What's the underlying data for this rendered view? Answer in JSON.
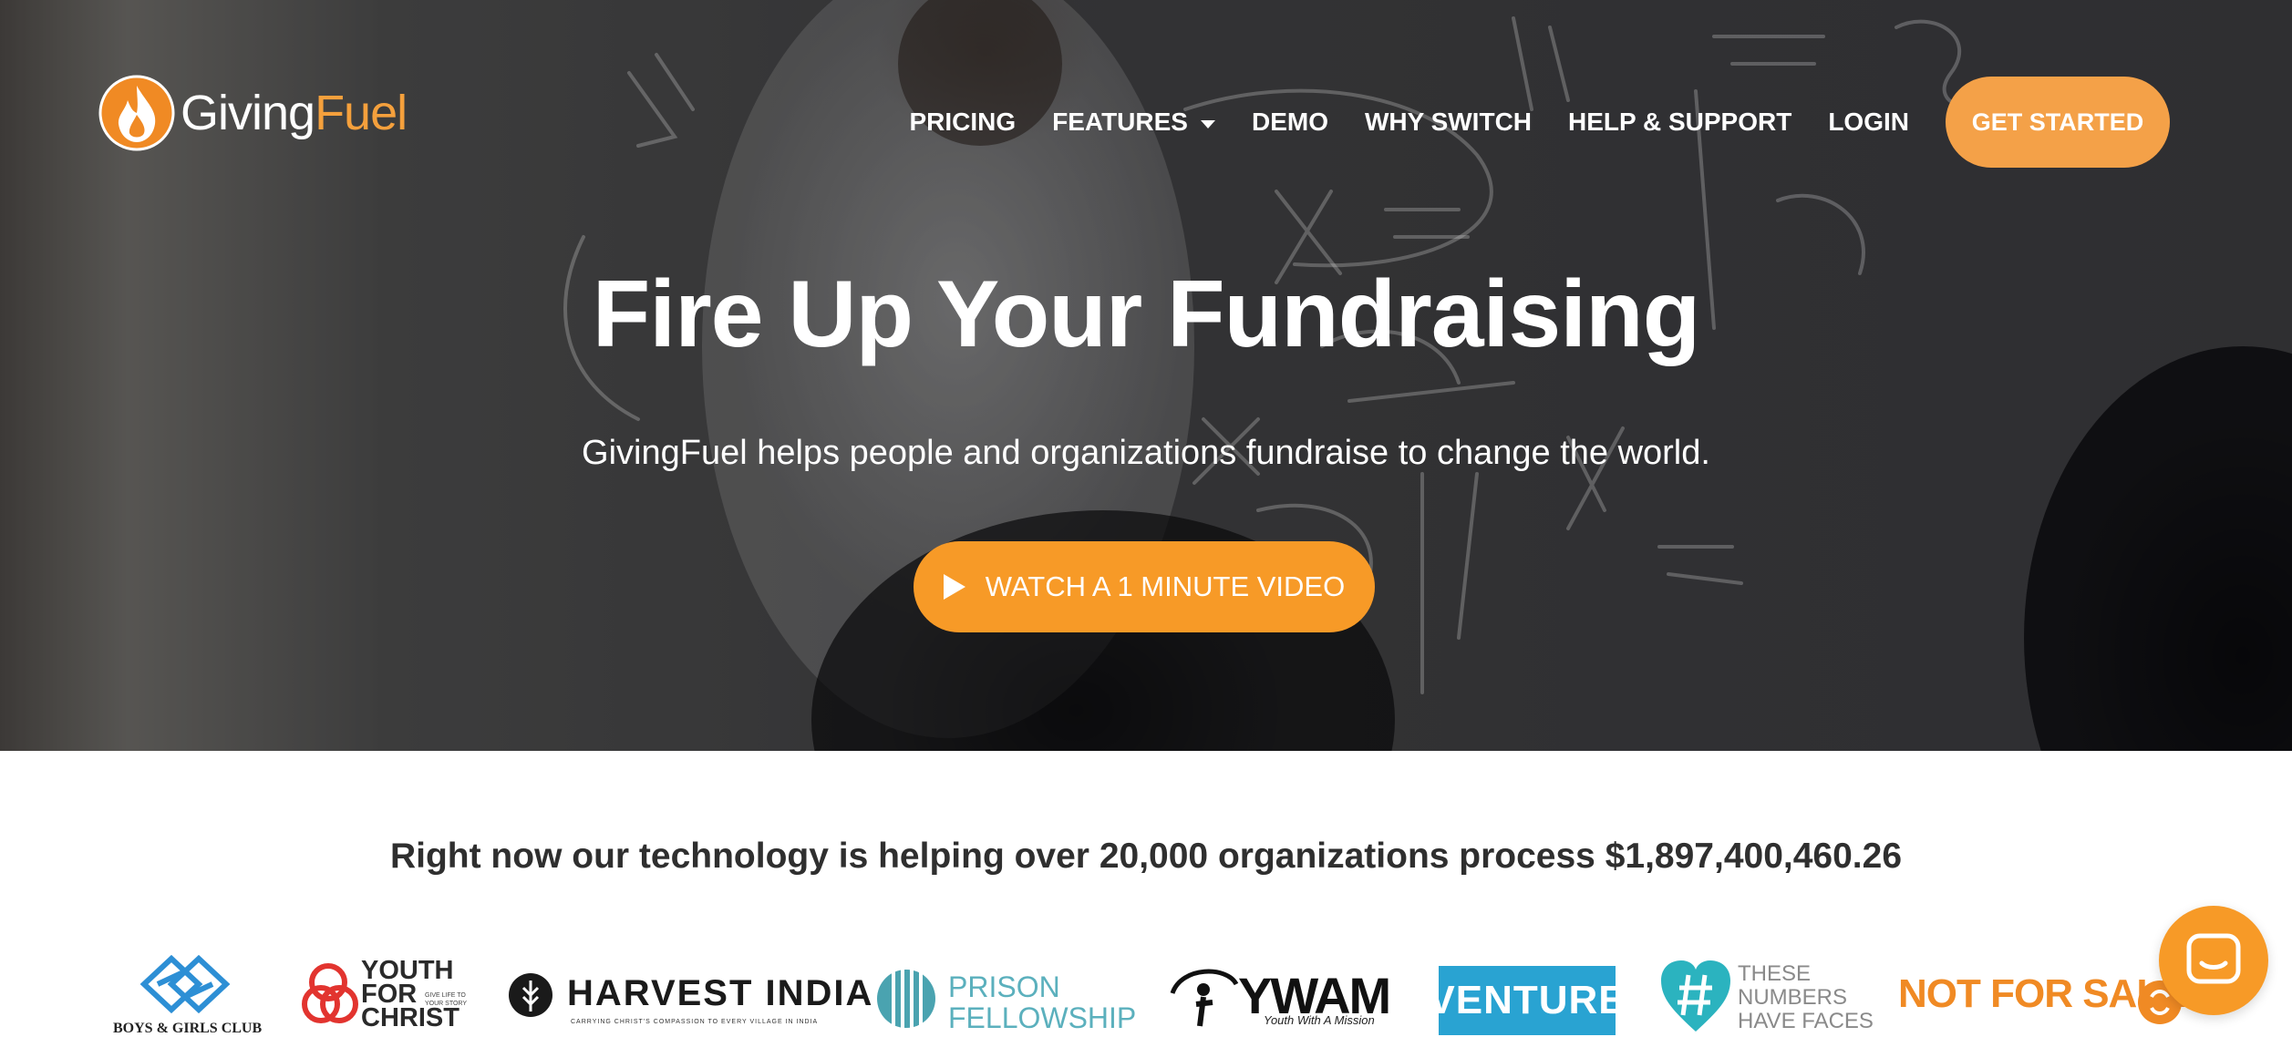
{
  "brand": {
    "name_part1": "Giving",
    "name_part2": "Fuel",
    "accent_color": "#f5a03c"
  },
  "nav": {
    "items": [
      {
        "label": "PRICING"
      },
      {
        "label": "FEATURES"
      },
      {
        "label": "DEMO"
      },
      {
        "label": "WHY SWITCH"
      },
      {
        "label": "HELP & SUPPORT"
      },
      {
        "label": "LOGIN"
      }
    ],
    "cta_label": "GET STARTED"
  },
  "hero": {
    "title": "Fire Up Your Fundraising",
    "subtitle": "GivingFuel helps people and organizations fundraise to change the world.",
    "video_button_label": "WATCH A 1 MINUTE VIDEO",
    "button_color": "#f79a27"
  },
  "stats": {
    "text": "Right now our technology is helping over 20,000 organizations process $1,897,400,460.26"
  },
  "client_logos": {
    "boys_girls": "BOYS & GIRLS CLUB",
    "yfc_line1": "YOUTH",
    "yfc_line2": "FOR",
    "yfc_line3": "CHRIST",
    "yfc_tagline": "GIVE LIFE TO YOUR STORY",
    "harvest": "HARVEST INDIA",
    "harvest_tagline": "CARRYING CHRIST'S COMPASSION TO EVERY VILLAGE IN INDIA",
    "prison_line1": "PRISON",
    "prison_line2": "FELLOWSHIP",
    "ywam": "YWAM",
    "ywam_tagline": "Youth With A Mission",
    "venture": "VENTURE",
    "numbers_line1": "THESE",
    "numbers_line2": "NUMBERS",
    "numbers_line3": "HAVE FACES",
    "notforsale": "NOT FOR SALE"
  },
  "icons": {
    "logo": "flame-icon",
    "play": "play-icon",
    "chat": "chat-icon",
    "dropdown": "caret-down-icon"
  }
}
